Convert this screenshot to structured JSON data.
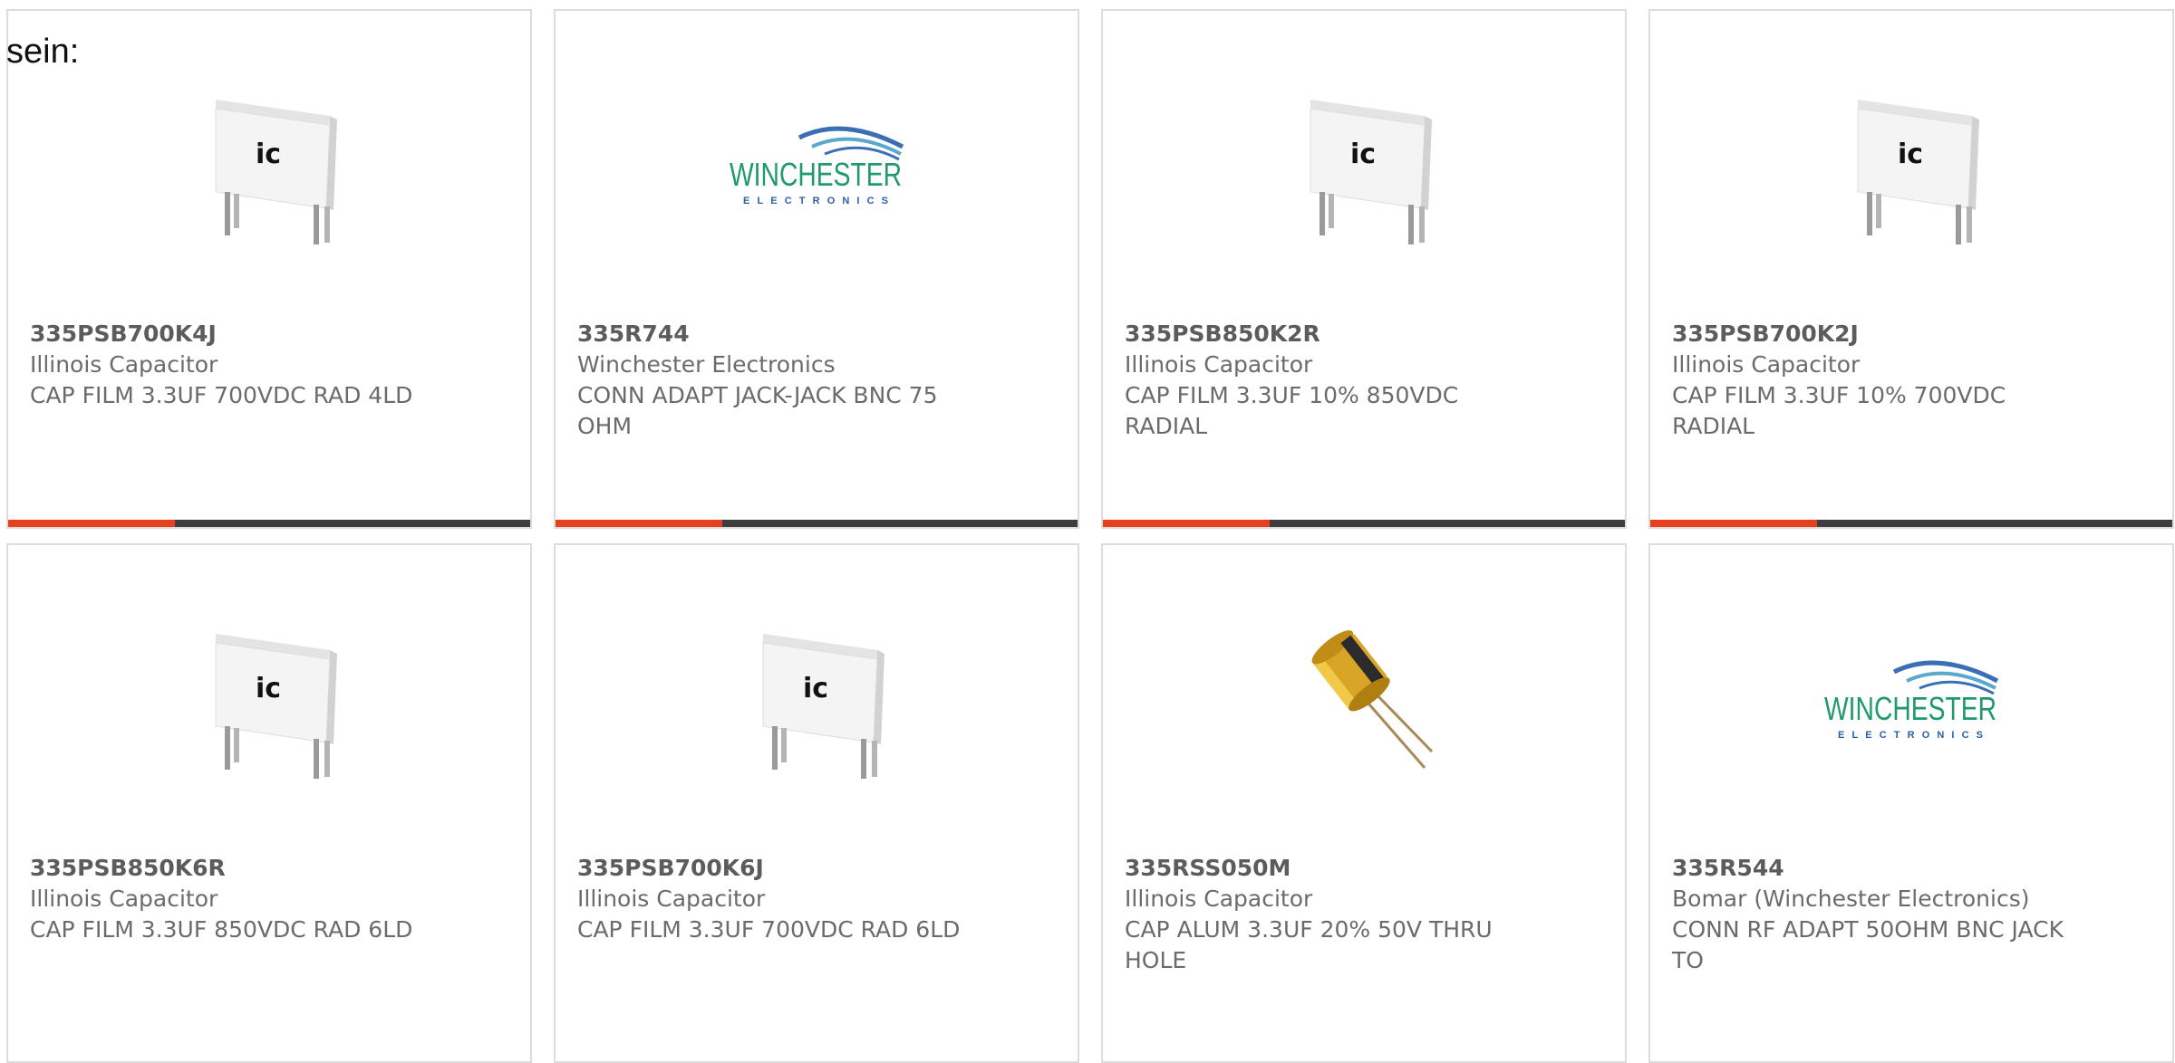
{
  "intro_text": "sein:",
  "accent_color": "#e8401c",
  "bar_color": "#3e3e3e",
  "products": [
    {
      "part_number": "335PSB700K4J",
      "manufacturer": "Illinois Capacitor",
      "description": "CAP FILM 3.3UF 700VDC RAD 4LD",
      "image": "film-capacitor-image",
      "bar_fill_fraction": 0.32
    },
    {
      "part_number": "335R744",
      "manufacturer": "Winchester Electronics",
      "description": "CONN ADAPT JACK-JACK BNC 75 OHM",
      "image": "winchester-logo-image",
      "bar_fill_fraction": 0.32
    },
    {
      "part_number": "335PSB850K2R",
      "manufacturer": "Illinois Capacitor",
      "description": "CAP FILM 3.3UF 10% 850VDC RADIAL",
      "image": "film-capacitor-image",
      "bar_fill_fraction": 0.32
    },
    {
      "part_number": "335PSB700K2J",
      "manufacturer": "Illinois Capacitor",
      "description": "CAP FILM 3.3UF 10% 700VDC RADIAL",
      "image": "film-capacitor-image",
      "bar_fill_fraction": 0.32
    },
    {
      "part_number": "335PSB850K6R",
      "manufacturer": "Illinois Capacitor",
      "description": "CAP FILM 3.3UF 850VDC RAD 6LD",
      "image": "film-capacitor-image"
    },
    {
      "part_number": "335PSB700K6J",
      "manufacturer": "Illinois Capacitor",
      "description": "CAP FILM 3.3UF 700VDC RAD 6LD",
      "image": "film-capacitor-image"
    },
    {
      "part_number": "335RSS050M",
      "manufacturer": "Illinois Capacitor",
      "description": "CAP ALUM 3.3UF 20% 50V THRU HOLE",
      "image": "electrolytic-capacitor-image"
    },
    {
      "part_number": "335R544",
      "manufacturer": "Bomar (Winchester Electronics)",
      "description": "CONN RF ADAPT 50OHM BNC JACK TO",
      "image": "winchester-logo-image"
    }
  ],
  "logos": {
    "winchester": {
      "name": "WINCHESTER",
      "tagline": "ELECTRONICS",
      "text_color": "#1f9a6a",
      "tagline_color": "#2a5fa8",
      "swoosh_color": "#3a6fb5"
    },
    "capacitor_mark": "ic"
  }
}
